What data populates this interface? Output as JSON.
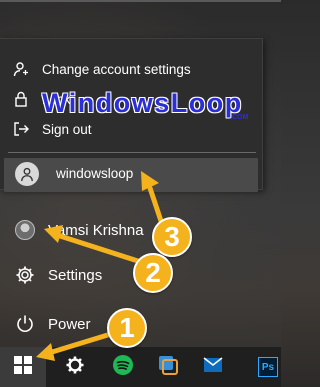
{
  "account_menu": {
    "items": [
      {
        "label": "Change account settings",
        "icon": "change-account-settings-icon"
      },
      {
        "label": "Lock",
        "icon": "lock-icon"
      },
      {
        "label": "Sign out",
        "icon": "sign-out-icon"
      }
    ],
    "other_user": {
      "label": "windowsloop",
      "icon": "user-avatar-icon"
    }
  },
  "start_menu": {
    "user": {
      "label": "Vamsi Krishna",
      "icon": "profile-picture"
    },
    "settings": {
      "label": "Settings",
      "icon": "gear-icon"
    },
    "power": {
      "label": "Power",
      "icon": "power-icon"
    }
  },
  "watermark": {
    "text": "WindowsLoop",
    "suffix": ".COM"
  },
  "callouts": {
    "one": "1",
    "two": "2",
    "three": "3"
  },
  "taskbar": {
    "items": [
      "windows-start-icon",
      "settings-gear-icon",
      "spotify-icon",
      "snip-tool-icon",
      "outlook-mail-icon",
      "photoshop-icon"
    ],
    "photoshop_label": "Ps"
  },
  "colors": {
    "callout": "#f4b21d",
    "watermark": "#2b2fd9",
    "popup_bg": "#2d2d2d",
    "selected_row": "#4a4a4a"
  }
}
